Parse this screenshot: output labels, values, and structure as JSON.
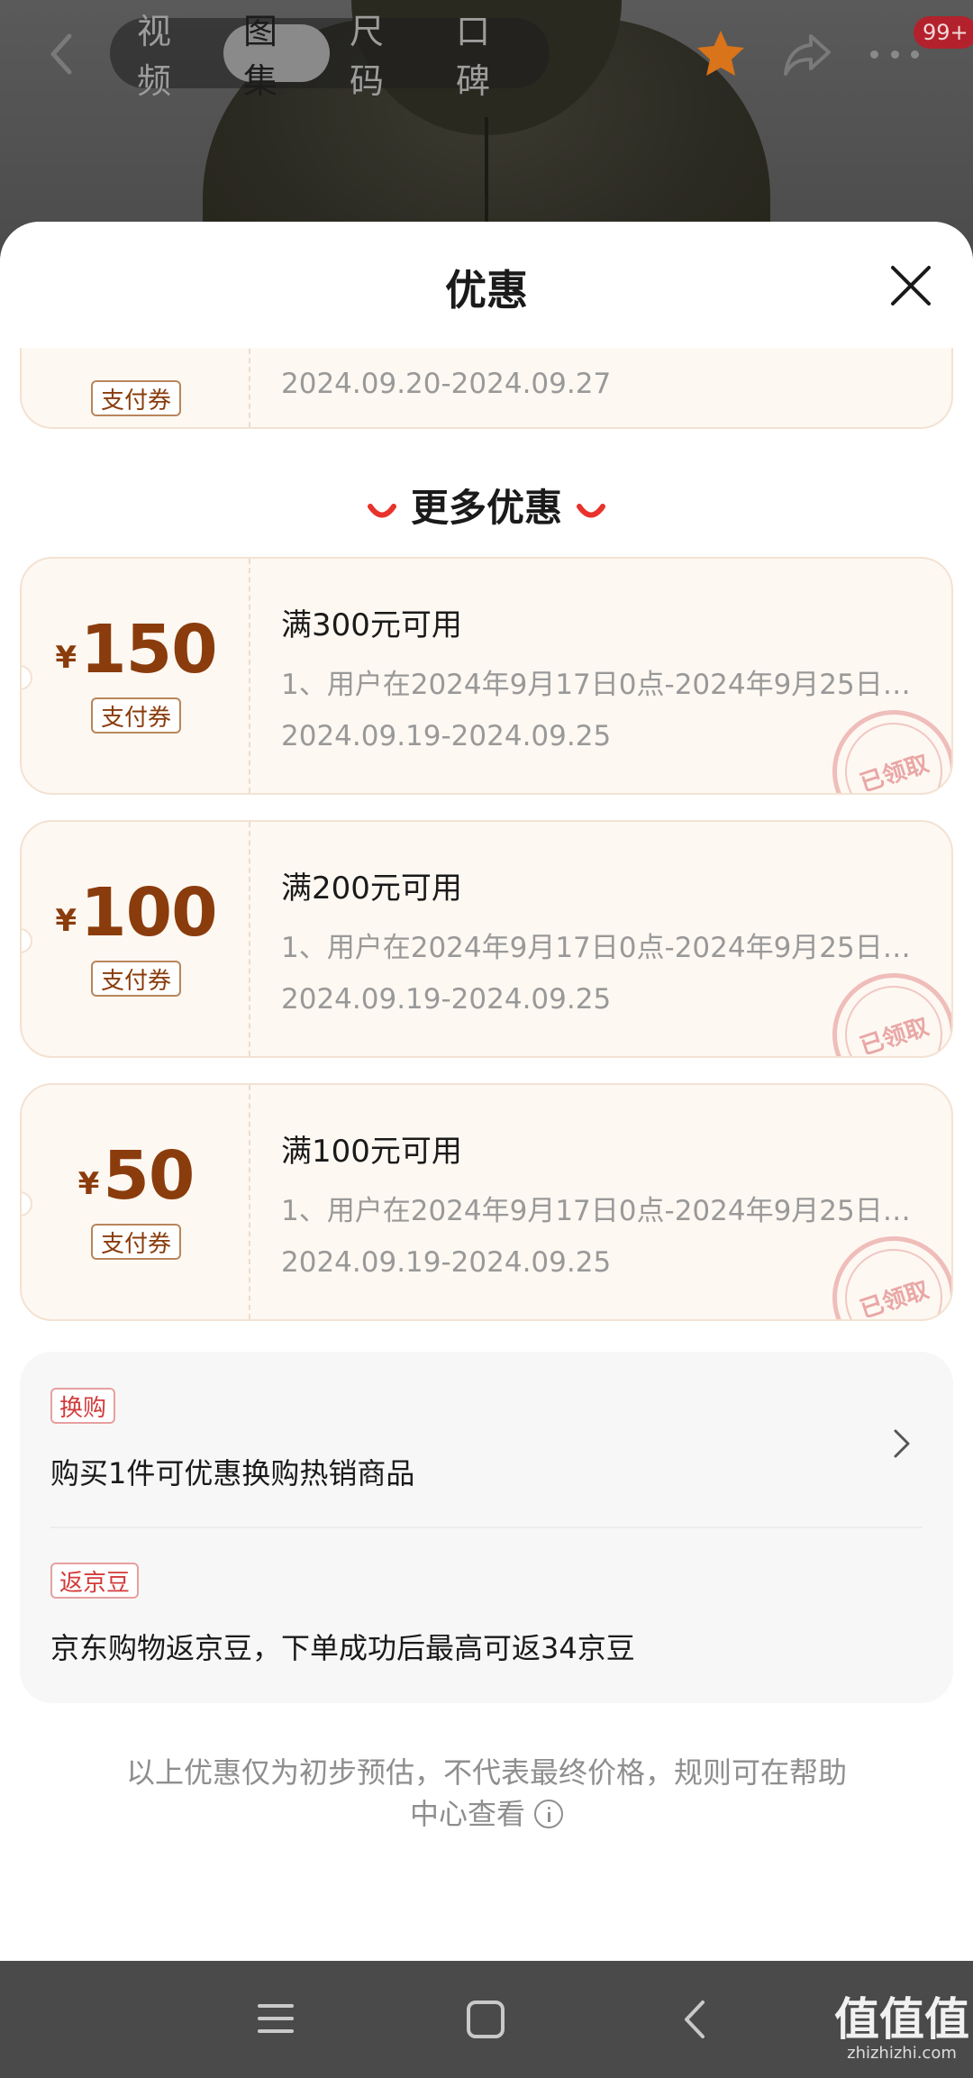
{
  "header": {
    "tabs": [
      {
        "label": "视频",
        "active": false
      },
      {
        "label": "图集",
        "active": true
      },
      {
        "label": "尺码",
        "active": false
      },
      {
        "label": "口碑",
        "active": false
      }
    ],
    "badge": "99+"
  },
  "sheet": {
    "title": "优惠",
    "partial_coupon": {
      "tag": "支付券",
      "date": "2024.09.20-2024.09.27"
    },
    "more_title": "更多优惠",
    "coupons": [
      {
        "currency": "¥",
        "amount": "150",
        "tag": "支付券",
        "condition": "满300元可用",
        "description": "1、用户在2024年9月17日0点-2024年9月25日…",
        "date": "2024.09.19-2024.09.25",
        "stamp": "已领取"
      },
      {
        "currency": "¥",
        "amount": "100",
        "tag": "支付券",
        "condition": "满200元可用",
        "description": "1、用户在2024年9月17日0点-2024年9月25日…",
        "date": "2024.09.19-2024.09.25",
        "stamp": "已领取"
      },
      {
        "currency": "¥",
        "amount": "50",
        "tag": "支付券",
        "condition": "满100元可用",
        "description": "1、用户在2024年9月17日0点-2024年9月25日…",
        "date": "2024.09.19-2024.09.25",
        "stamp": "已领取"
      }
    ],
    "promos": [
      {
        "tag": "换购",
        "text": "购买1件可优惠换购热销商品"
      },
      {
        "tag": "返京豆",
        "text": "京东购物返京豆，下单成功后最高可返34京豆"
      }
    ],
    "disclaimer": "以上优惠仅为初步预估，不代表最终价格，规则可在帮助中心查看"
  },
  "watermark": {
    "title": "值值值",
    "url": "zhizhizhi.com"
  },
  "colors": {
    "accent": "#8a3c0c",
    "coupon_bg": "#fef8f2",
    "promo_tag": "#d33b3b",
    "favorite": "#d9741a"
  },
  "icons": [
    "back-icon",
    "star-icon",
    "share-icon",
    "more-icon",
    "close-icon",
    "chevron-right-icon",
    "info-icon",
    "menu-icon",
    "home-icon",
    "nav-back-icon"
  ]
}
